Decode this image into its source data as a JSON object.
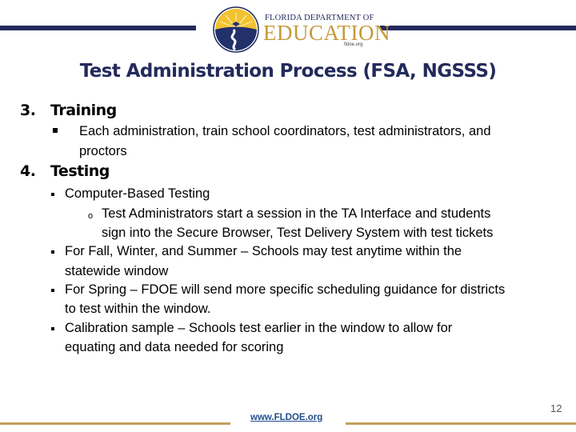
{
  "header": {
    "logo": {
      "line1": "FLORIDA DEPARTMENT OF",
      "line2": "EDUCATION",
      "line3": "fldoe.org",
      "icon": "fldoe-seal-icon"
    },
    "colors": {
      "navy": "#232a5c",
      "gold": "#c0a05a",
      "link": "#1f4e8c"
    }
  },
  "slide": {
    "title": "Test Administration Process (FSA, NGSSS)",
    "sections": [
      {
        "number": "3.",
        "heading": "Training",
        "bullets": [
          {
            "lines": [
              "Each administration, train school coordinators, test administrators, and",
              "proctors"
            ]
          }
        ]
      },
      {
        "number": "4.",
        "heading": "Testing",
        "bullets": [
          {
            "lines": [
              "Computer-Based Testing"
            ],
            "sub_bullets": [
              {
                "lines": [
                  "Test Administrators start a session in the TA Interface and students",
                  "sign into the Secure Browser, Test Delivery System with test tickets"
                ]
              }
            ]
          },
          {
            "lines": [
              "For Fall, Winter, and Summer – Schools may test anytime within the",
              "statewide window"
            ]
          },
          {
            "lines": [
              "For Spring – FDOE will send more specific scheduling guidance for districts",
              "to test within the window."
            ]
          },
          {
            "lines": [
              "Calibration sample – Schools test earlier in the window to allow for",
              "equating and data needed for scoring"
            ]
          }
        ]
      }
    ]
  },
  "footer": {
    "link": "www.FLDOE.org",
    "page_number": "12"
  }
}
